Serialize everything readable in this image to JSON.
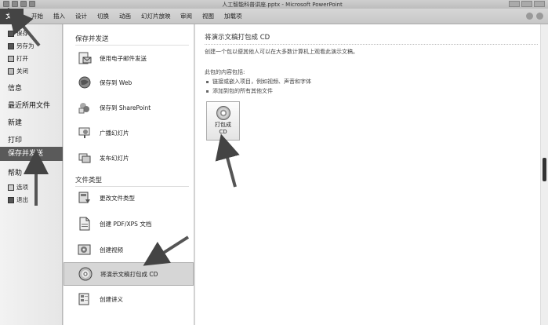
{
  "window": {
    "title": "人工智能科普讲座.pptx - Microsoft PowerPoint"
  },
  "ribbon": {
    "tabs": [
      "文件",
      "开始",
      "插入",
      "设计",
      "切换",
      "动画",
      "幻灯片放映",
      "审阅",
      "视图",
      "加载项"
    ]
  },
  "leftnav": {
    "small_top": [
      {
        "label": "保存",
        "icon": "save-icon"
      },
      {
        "label": "另存为",
        "icon": "save-as-icon"
      },
      {
        "label": "打开",
        "icon": "open-folder-icon"
      },
      {
        "label": "关闭",
        "icon": "close-doc-icon"
      }
    ],
    "big": [
      "信息",
      "最近所用文件",
      "新建",
      "打印",
      "保存并发送",
      "帮助"
    ],
    "small_bottom": [
      {
        "label": "选项",
        "icon": "options-icon"
      },
      {
        "label": "退出",
        "icon": "exit-icon"
      }
    ],
    "selected_index": 4
  },
  "middle": {
    "section1_title": "保存并发送",
    "section1_items": [
      {
        "label": "使用电子邮件发送",
        "icon": "email-icon"
      },
      {
        "label": "保存到 Web",
        "icon": "globe-icon"
      },
      {
        "label": "保存到 SharePoint",
        "icon": "sharepoint-icon"
      },
      {
        "label": "广播幻灯片",
        "icon": "broadcast-icon"
      },
      {
        "label": "发布幻灯片",
        "icon": "publish-icon"
      }
    ],
    "section2_title": "文件类型",
    "section2_items": [
      {
        "label": "更改文件类型",
        "icon": "change-type-icon"
      },
      {
        "label": "创建 PDF/XPS 文档",
        "icon": "pdf-icon"
      },
      {
        "label": "创建视频",
        "icon": "video-icon"
      },
      {
        "label": "将演示文稿打包成 CD",
        "icon": "cd-icon"
      },
      {
        "label": "创建讲义",
        "icon": "handout-icon"
      }
    ]
  },
  "right": {
    "title": "将演示文稿打包成 CD",
    "description": "创建一个包以便其他人可以在大多数计算机上观看此演示文稿。",
    "contents_heading": "此包的内容包括:",
    "bullets": [
      "链接或嵌入项目，例如视频、声音和字体",
      "添加到包的所有其他文件"
    ],
    "button_label_line1": "打包成",
    "button_label_line2": "CD"
  }
}
